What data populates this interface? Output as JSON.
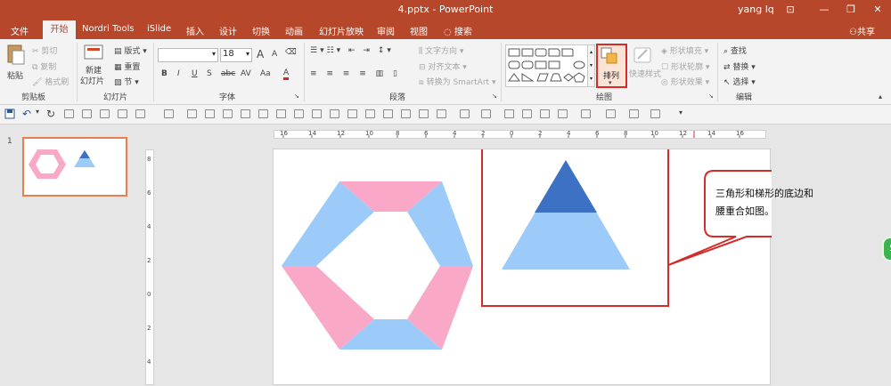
{
  "window": {
    "title": "4.pptx  -  PowerPoint",
    "user": "yang lq",
    "controls": {
      "ribbon_display": "⊡",
      "minimize": "—",
      "restore": "❐",
      "close": "✕"
    }
  },
  "tabs": [
    "文件",
    "开始",
    "Nordri Tools",
    "iSlide",
    "插入",
    "设计",
    "切换",
    "动画",
    "幻灯片放映",
    "审阅",
    "视图"
  ],
  "active_tab": "开始",
  "tell_me": "搜索",
  "share": "共享",
  "ribbon": {
    "clipboard": {
      "group": "剪贴板",
      "paste": "粘贴",
      "cut": "剪切",
      "copy": "复制",
      "format_painter": "格式刷"
    },
    "slides": {
      "group": "幻灯片",
      "new_slide": "新建",
      "new_slide2": "幻灯片",
      "layout": "版式",
      "reset": "重置",
      "section": "节"
    },
    "font": {
      "group": "字体",
      "font_name": "",
      "font_size": "18",
      "grow": "A",
      "shrink": "A",
      "bold": "B",
      "italic": "I",
      "underline": "U",
      "strike": "S",
      "abc": "abc",
      "spacing": "AV",
      "case": "Aa",
      "color": "A"
    },
    "paragraph": {
      "group": "段落",
      "text_direction": "文字方向",
      "align_text": "对齐文本",
      "smartart": "转换为 SmartArt"
    },
    "drawing": {
      "group": "绘图",
      "arrange": "排列",
      "quick_styles": "快速样式",
      "shape_fill": "形状填充",
      "shape_outline": "形状轮廓",
      "shape_effects": "形状效果"
    },
    "editing": {
      "group": "编辑",
      "find": "查找",
      "replace": "替换",
      "select": "选择"
    }
  },
  "thumbnails": [
    {
      "number": "1"
    }
  ],
  "ruler": {
    "horizontal": [
      "16",
      "14",
      "12",
      "10",
      "8",
      "6",
      "4",
      "2",
      "0",
      "2",
      "4",
      "6",
      "8",
      "10",
      "12",
      "14",
      "16"
    ],
    "vertical": [
      "8",
      "6",
      "4",
      "2",
      "0",
      "2",
      "4"
    ]
  },
  "slide": {
    "callout_text": "三角形和梯形的底边和腰重合如图。",
    "colors": {
      "pink": "#f9a8c7",
      "light_blue": "#9ccbfa",
      "dark_blue": "#3d71c4",
      "highlight": "#d42b2b"
    }
  },
  "status_badge": "5"
}
